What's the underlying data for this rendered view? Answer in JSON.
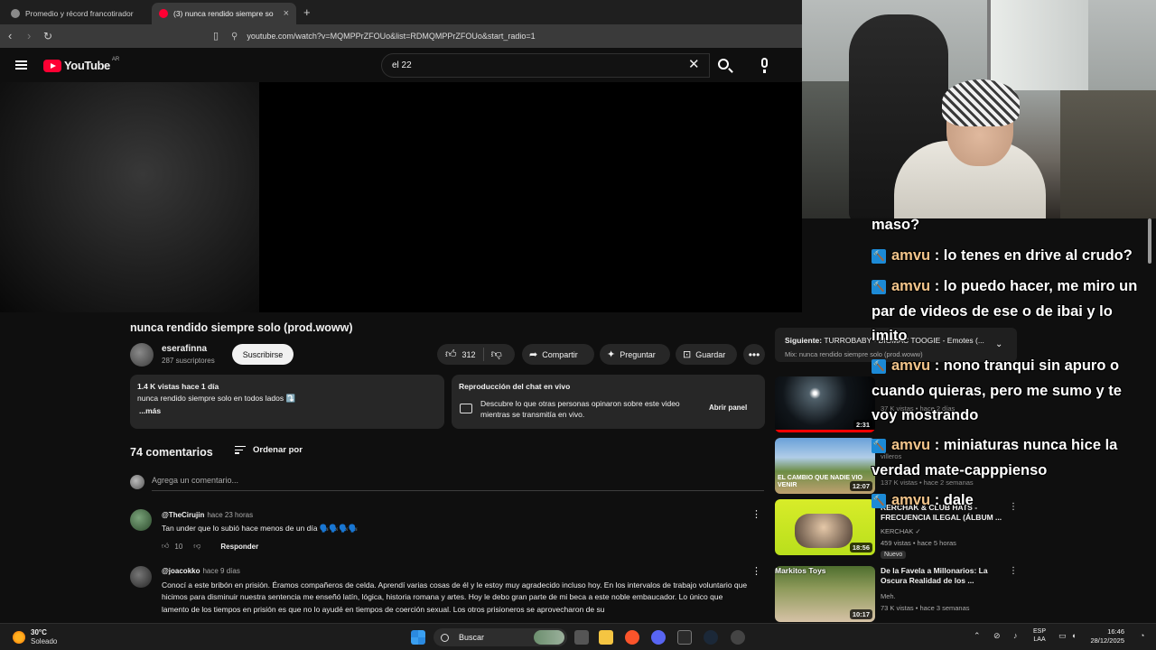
{
  "browser": {
    "tabs": [
      {
        "label": "Promedio y récord francotirador",
        "active": false
      },
      {
        "label": "(3) nunca rendido siempre so",
        "active": true
      }
    ],
    "new_tab": "+",
    "tab_close": "×",
    "url": "youtube.com/watch?v=MQMPPrZFOUo&list=RDMQMPPrZFOUo&start_radio=1"
  },
  "youtube": {
    "logo_text": "YouTube",
    "country_code": "AR",
    "search_value": "el 22",
    "clear_glyph": "✕"
  },
  "video": {
    "title": "nunca rendido siempre solo (prod.woww)",
    "channel": "eserafinna",
    "subscribers": "287 suscriptores",
    "subscribe_label": "Suscribirse",
    "likes": "312",
    "share_label": "Compartir",
    "ask_label": "Preguntar",
    "save_label": "Guardar",
    "more_glyph": "•••"
  },
  "description": {
    "meta": "1.4 K vistas  hace 1 día",
    "text": "nunca rendido siempre solo en todos lados ⤵️",
    "more": "...más"
  },
  "chat_replay": {
    "title": "Reproducción del chat en vivo",
    "text": "Descubre lo que otras personas opinaron sobre este video mientras se transmitía en vivo.",
    "button": "Abrir panel"
  },
  "comments": {
    "count_label": "74 comentarios",
    "sort_label": "Ordenar por",
    "add_placeholder": "Agrega un comentario...",
    "items": [
      {
        "author": "@TheCirujin",
        "time": "hace 23 horas",
        "text": "Tan under que lo subió hace menos de un día 🗣️🗣️🗣️🗣️",
        "likes": "10",
        "reply": "Responder"
      },
      {
        "author": "@joacokko",
        "time": "hace 9 días",
        "text": "Conocí a este bribón en prisión. Éramos compañeros de celda. Aprendí varias cosas de él y le estoy muy agradecido incluso hoy. En los intervalos de trabajo voluntario que hicimos para disminuir nuestra sentencia me enseñó latín, lógica, historia romana y artes. Hoy le debo gran parte de mi beca a este noble embaucador. Lo único que lamento de los tiempos en prisión es que no lo ayudé en tiempos de coerción sexual. Los otros prisioneros se aprovecharon de su"
      }
    ],
    "kebab": "⋮"
  },
  "up_next": {
    "label": "Siguiente:",
    "title": "TURROBABY - BIGMAC TOOGIE - Emotes (...",
    "mix": "Mix: nunca rendido siempre solo (prod.woww)",
    "chevron": "⌄"
  },
  "recommendations": [
    {
      "duration": "2:31",
      "meta": [
        "37 K vistas • hace 2 días"
      ]
    },
    {
      "duration": "12:07",
      "thumb_caption": "EL CAMBIO QUE NADIE VIO VENIR",
      "title": "villeros",
      "meta": [
        "137 K vistas • hace 2 semanas"
      ]
    },
    {
      "duration": "18:56",
      "title": "KERCHAK & CLUB HATS - FRECUENCIA ILEGAL (ÁLBUM ...",
      "meta": [
        "KERCHAK ✓",
        "459 vistas • hace 5 horas"
      ],
      "badge": "Nuevo"
    },
    {
      "duration": "10:17",
      "thumb_caption": "Markitos Toys",
      "title": "De la Favela a Millonarios: La Oscura Realidad de los ...",
      "meta": [
        "Meh.",
        "73 K vistas • hace 3 semanas"
      ]
    }
  ],
  "stream_chat": [
    {
      "text": "maso?"
    },
    {
      "user": "amvu",
      "text": "lo tenes en drive al crudo?"
    },
    {
      "user": "amvu",
      "text": "lo puedo hacer, me miro un par de videos de ese o de ibai y lo imito"
    },
    {
      "user": "amvu",
      "text": "nono tranqui sin apuro o cuando quieras, pero me sumo y te voy mostrando"
    },
    {
      "user": "amvu",
      "text": "miniaturas nunca hice la verdad mate-capppienso"
    },
    {
      "user": "amvu",
      "text": "dale"
    }
  ],
  "chat_badge_glyph": "🔨",
  "taskbar": {
    "temperature": "30°C",
    "weather": "Soleado",
    "search_label": "Buscar",
    "lang_line1": "ESP",
    "lang_line2": "LAA",
    "time": "16:46",
    "date": "28/12/2025"
  }
}
